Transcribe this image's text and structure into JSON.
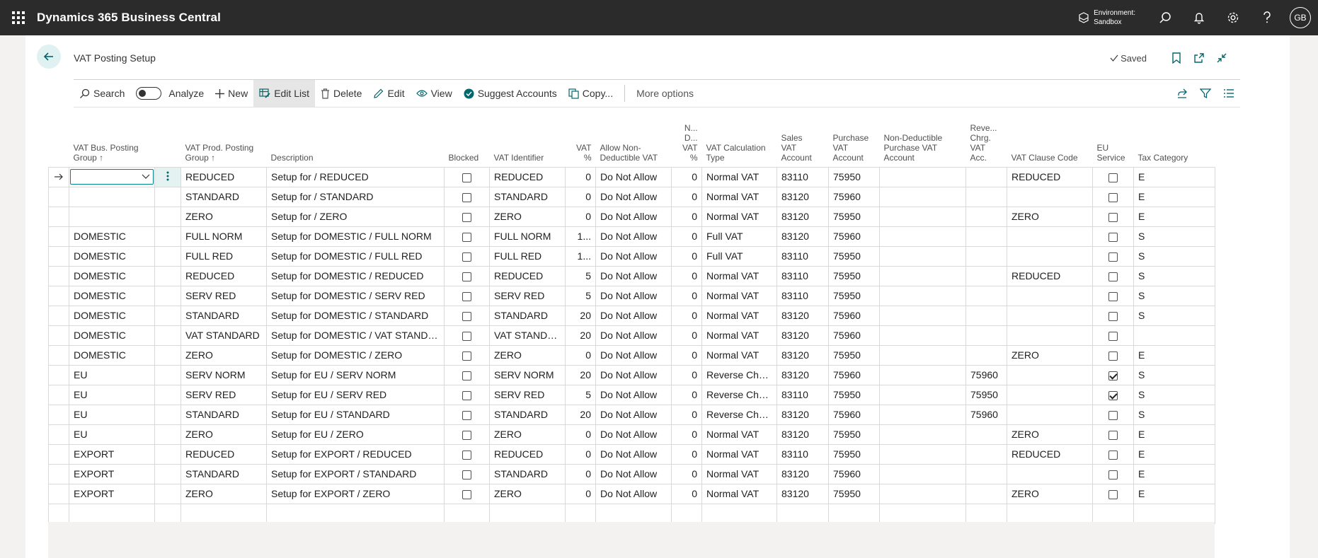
{
  "app": {
    "title": "Dynamics 365 Business Central"
  },
  "environment": {
    "label": "Environment:",
    "value": "Sandbox"
  },
  "user": {
    "initials": "GB"
  },
  "page": {
    "title": "VAT Posting Setup",
    "status": "Saved"
  },
  "actions": {
    "search": "Search",
    "analyze": "Analyze",
    "new": "New",
    "edit_list": "Edit List",
    "delete": "Delete",
    "edit": "Edit",
    "view": "View",
    "suggest_accounts": "Suggest Accounts",
    "copy": "Copy...",
    "more_options": "More options"
  },
  "columns": [
    [
      "VAT Bus. Posting",
      "Group ↑"
    ],
    [
      "VAT Prod. Posting",
      "Group ↑"
    ],
    [
      "Description"
    ],
    [
      "Blocked"
    ],
    [
      "VAT Identifier"
    ],
    [
      "VAT",
      "%"
    ],
    [
      "Allow Non-",
      "Deductible VAT"
    ],
    [
      "N...",
      "D...",
      "VAT",
      "%"
    ],
    [
      "VAT Calculation",
      "Type"
    ],
    [
      "Sales",
      "VAT",
      "Account"
    ],
    [
      "Purchase",
      "VAT",
      "Account"
    ],
    [
      "Non-Deductible",
      "Purchase VAT",
      "Account"
    ],
    [
      "Reve...",
      "Chrg.",
      "VAT",
      "Acc."
    ],
    [
      "VAT Clause Code"
    ],
    [
      "EU",
      "Service"
    ],
    [
      "Tax Category"
    ]
  ],
  "rows": [
    {
      "bus": "",
      "prod": "REDUCED",
      "desc": "Setup for  / REDUCED",
      "blocked": false,
      "ident": "REDUCED",
      "vat": "0",
      "allow": "Do Not Allow",
      "nd": "0",
      "calc": "Normal VAT",
      "sales": "83110",
      "purch": "75950",
      "ndacc": "",
      "rev": "",
      "clause": "REDUCED",
      "eu": false,
      "tax": "E"
    },
    {
      "bus": "",
      "prod": "STANDARD",
      "desc": "Setup for  / STANDARD",
      "blocked": false,
      "ident": "STANDARD",
      "vat": "0",
      "allow": "Do Not Allow",
      "nd": "0",
      "calc": "Normal VAT",
      "sales": "83120",
      "purch": "75960",
      "ndacc": "",
      "rev": "",
      "clause": "",
      "eu": false,
      "tax": "E"
    },
    {
      "bus": "",
      "prod": "ZERO",
      "desc": "Setup for  / ZERO",
      "blocked": false,
      "ident": "ZERO",
      "vat": "0",
      "allow": "Do Not Allow",
      "nd": "0",
      "calc": "Normal VAT",
      "sales": "83120",
      "purch": "75950",
      "ndacc": "",
      "rev": "",
      "clause": "ZERO",
      "eu": false,
      "tax": "E"
    },
    {
      "bus": "DOMESTIC",
      "prod": "FULL NORM",
      "desc": "Setup for DOMESTIC / FULL NORM",
      "blocked": false,
      "ident": "FULL NORM",
      "vat": "1...",
      "allow": "Do Not Allow",
      "nd": "0",
      "calc": "Full VAT",
      "sales": "83120",
      "purch": "75960",
      "ndacc": "",
      "rev": "",
      "clause": "",
      "eu": false,
      "tax": "S"
    },
    {
      "bus": "DOMESTIC",
      "prod": "FULL RED",
      "desc": "Setup for DOMESTIC / FULL RED",
      "blocked": false,
      "ident": "FULL RED",
      "vat": "1...",
      "allow": "Do Not Allow",
      "nd": "0",
      "calc": "Full VAT",
      "sales": "83110",
      "purch": "75950",
      "ndacc": "",
      "rev": "",
      "clause": "",
      "eu": false,
      "tax": "S"
    },
    {
      "bus": "DOMESTIC",
      "prod": "REDUCED",
      "desc": "Setup for DOMESTIC / REDUCED",
      "blocked": false,
      "ident": "REDUCED",
      "vat": "5",
      "allow": "Do Not Allow",
      "nd": "0",
      "calc": "Normal VAT",
      "sales": "83110",
      "purch": "75950",
      "ndacc": "",
      "rev": "",
      "clause": "REDUCED",
      "eu": false,
      "tax": "S"
    },
    {
      "bus": "DOMESTIC",
      "prod": "SERV RED",
      "desc": "Setup for DOMESTIC / SERV RED",
      "blocked": false,
      "ident": "SERV RED",
      "vat": "5",
      "allow": "Do Not Allow",
      "nd": "0",
      "calc": "Normal VAT",
      "sales": "83110",
      "purch": "75950",
      "ndacc": "",
      "rev": "",
      "clause": "",
      "eu": false,
      "tax": "S"
    },
    {
      "bus": "DOMESTIC",
      "prod": "STANDARD",
      "desc": "Setup for DOMESTIC / STANDARD",
      "blocked": false,
      "ident": "STANDARD",
      "vat": "20",
      "allow": "Do Not Allow",
      "nd": "0",
      "calc": "Normal VAT",
      "sales": "83120",
      "purch": "75960",
      "ndacc": "",
      "rev": "",
      "clause": "",
      "eu": false,
      "tax": "S"
    },
    {
      "bus": "DOMESTIC",
      "prod": "VAT STANDARD",
      "desc": "Setup for DOMESTIC / VAT STANDARD",
      "blocked": false,
      "ident": "VAT STANDARD",
      "vat": "20",
      "allow": "Do Not Allow",
      "nd": "0",
      "calc": "Normal VAT",
      "sales": "83120",
      "purch": "75960",
      "ndacc": "",
      "rev": "",
      "clause": "",
      "eu": false,
      "tax": ""
    },
    {
      "bus": "DOMESTIC",
      "prod": "ZERO",
      "desc": "Setup for DOMESTIC / ZERO",
      "blocked": false,
      "ident": "ZERO",
      "vat": "0",
      "allow": "Do Not Allow",
      "nd": "0",
      "calc": "Normal VAT",
      "sales": "83120",
      "purch": "75950",
      "ndacc": "",
      "rev": "",
      "clause": "ZERO",
      "eu": false,
      "tax": "E"
    },
    {
      "bus": "EU",
      "prod": "SERV NORM",
      "desc": "Setup for EU / SERV NORM",
      "blocked": false,
      "ident": "SERV NORM",
      "vat": "20",
      "allow": "Do Not Allow",
      "nd": "0",
      "calc": "Reverse Charg...",
      "sales": "83120",
      "purch": "75960",
      "ndacc": "",
      "rev": "75960",
      "clause": "",
      "eu": true,
      "tax": "S"
    },
    {
      "bus": "EU",
      "prod": "SERV RED",
      "desc": "Setup for EU / SERV RED",
      "blocked": false,
      "ident": "SERV RED",
      "vat": "5",
      "allow": "Do Not Allow",
      "nd": "0",
      "calc": "Reverse Charg...",
      "sales": "83110",
      "purch": "75950",
      "ndacc": "",
      "rev": "75950",
      "clause": "",
      "eu": true,
      "tax": "S"
    },
    {
      "bus": "EU",
      "prod": "STANDARD",
      "desc": "Setup for EU / STANDARD",
      "blocked": false,
      "ident": "STANDARD",
      "vat": "20",
      "allow": "Do Not Allow",
      "nd": "0",
      "calc": "Reverse Charg...",
      "sales": "83120",
      "purch": "75960",
      "ndacc": "",
      "rev": "75960",
      "clause": "",
      "eu": false,
      "tax": "S"
    },
    {
      "bus": "EU",
      "prod": "ZERO",
      "desc": "Setup for EU / ZERO",
      "blocked": false,
      "ident": "ZERO",
      "vat": "0",
      "allow": "Do Not Allow",
      "nd": "0",
      "calc": "Normal VAT",
      "sales": "83120",
      "purch": "75950",
      "ndacc": "",
      "rev": "",
      "clause": "ZERO",
      "eu": false,
      "tax": "E"
    },
    {
      "bus": "EXPORT",
      "prod": "REDUCED",
      "desc": "Setup for EXPORT / REDUCED",
      "blocked": false,
      "ident": "REDUCED",
      "vat": "0",
      "allow": "Do Not Allow",
      "nd": "0",
      "calc": "Normal VAT",
      "sales": "83110",
      "purch": "75950",
      "ndacc": "",
      "rev": "",
      "clause": "REDUCED",
      "eu": false,
      "tax": "E"
    },
    {
      "bus": "EXPORT",
      "prod": "STANDARD",
      "desc": "Setup for EXPORT / STANDARD",
      "blocked": false,
      "ident": "STANDARD",
      "vat": "0",
      "allow": "Do Not Allow",
      "nd": "0",
      "calc": "Normal VAT",
      "sales": "83120",
      "purch": "75960",
      "ndacc": "",
      "rev": "",
      "clause": "",
      "eu": false,
      "tax": "E"
    },
    {
      "bus": "EXPORT",
      "prod": "ZERO",
      "desc": "Setup for EXPORT / ZERO",
      "blocked": false,
      "ident": "ZERO",
      "vat": "0",
      "allow": "Do Not Allow",
      "nd": "0",
      "calc": "Normal VAT",
      "sales": "83120",
      "purch": "75950",
      "ndacc": "",
      "rev": "",
      "clause": "ZERO",
      "eu": false,
      "tax": "E"
    }
  ],
  "colors": {
    "accent": "#008489",
    "topbar": "#2b2b2b"
  }
}
